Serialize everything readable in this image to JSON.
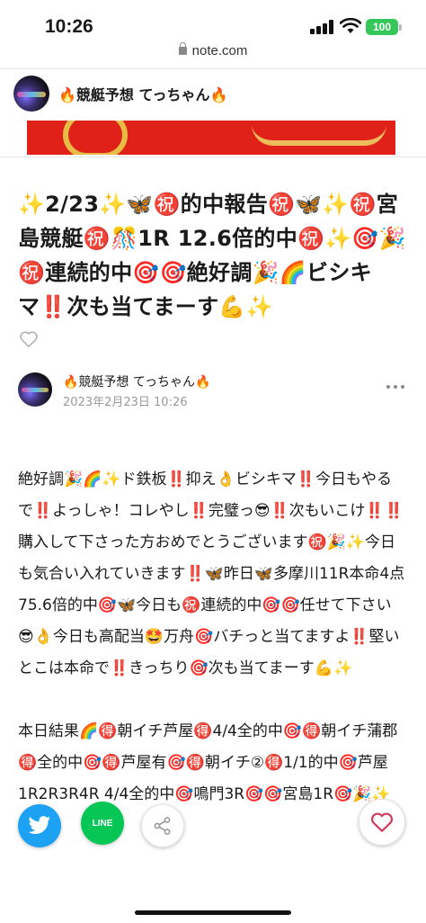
{
  "status_bar": {
    "time": "10:26",
    "battery": "100",
    "icons": [
      "signal-icon",
      "wifi-icon",
      "battery-icon"
    ]
  },
  "url_bar": {
    "domain": "note.com",
    "icon": "lock-icon"
  },
  "header": {
    "author_name": "🔥競艇予想 てっちゃん🔥"
  },
  "article": {
    "title": "✨2/23✨🦋㊗️的中報告㊗️🦋✨㊗️宮島競艇㊗️🎊1R 12.6倍的中㊗️✨🎯🎉㊗️連続的中🎯🎯絶好調🎉🌈ビシキマ‼️次も当てまーす💪✨",
    "author_name": "🔥競艇予想 てっちゃん🔥",
    "date": "2023年2月23日 10:26",
    "body": [
      "絶好調🎉🌈✨ド鉄板‼️抑え👌ビシキマ‼️今日もやるで‼️よっしゃ！コレやし‼️完璧っ😎‼️次もいこけ‼️‼️購入して下さった方おめでとうございます㊗️🎉✨今日も気合い入れていきます‼️🦋昨日🦋多摩川11R本命4点 75.6倍的中🎯🦋今日も㊗️連続的中🎯🎯任せて下さい😎👌今日も高配当🤩万舟🎯バチっと当てますよ‼️堅いとこは本命で‼️きっちり🎯次も当てまーす💪✨",
      "本日結果🌈🉐朝イチ芦屋🉐4/4全的中🎯🉐朝イチ蒲郡🉐全的中🎯🉐芦屋有🎯🉐朝イチ②🉐1/1的中🎯芦屋1R2R3R4R 4/4全的中🎯鳴門3R🎯🎯宮島1R🎯🎉✨"
    ]
  },
  "share_bar": {
    "line_label": "LINE",
    "buttons": [
      "twitter-icon",
      "line-icon",
      "share-icon",
      "heart-icon"
    ]
  }
}
